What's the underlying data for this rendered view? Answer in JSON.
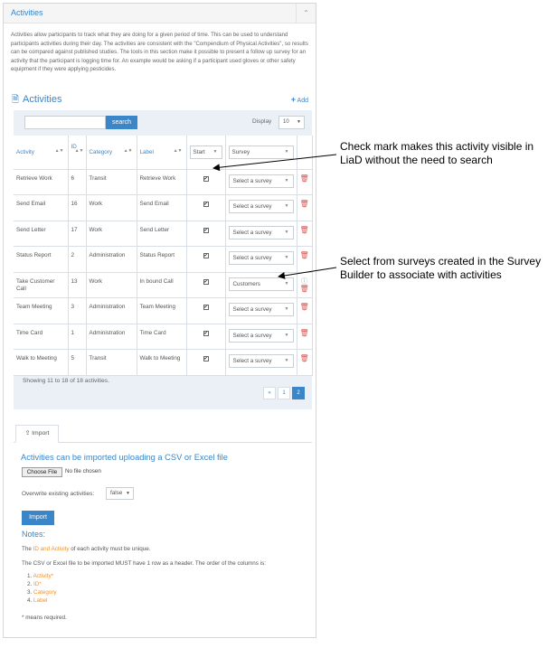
{
  "panel": {
    "title": "Activities"
  },
  "intro": "Activities allow participants to track what they are doing for a given period of time. This can be used to understand participants activities during their day. The activities are consistent with the \"Compendium of Physical Activities\", so results can be compared against published studies. The tools in this section make it possible to present a follow up survey for an activity that the participant is logging time for. An example would be asking if a participant used gloves or other safety equipment if they were applying pesticides.",
  "section": {
    "title": "Activities",
    "add_label": "Add"
  },
  "search": {
    "button_label": "search",
    "placeholder": ""
  },
  "display": {
    "label": "Display",
    "value": "10"
  },
  "columns": {
    "activity": "Activity",
    "id": "ID",
    "category": "Category",
    "label": "Label",
    "start": "Start",
    "survey": "Survey"
  },
  "rows": [
    {
      "activity": "Retrieve Work",
      "id": "6",
      "category": "Transit",
      "label": "Retrieve Work",
      "start": true,
      "survey": "Select a survey"
    },
    {
      "activity": "Send Email",
      "id": "16",
      "category": "Work",
      "label": "Send Email",
      "start": true,
      "survey": "Select a survey"
    },
    {
      "activity": "Send Letter",
      "id": "17",
      "category": "Work",
      "label": "Send Letter",
      "start": true,
      "survey": "Select a survey"
    },
    {
      "activity": "Status Report",
      "id": "2",
      "category": "Administration",
      "label": "Status Report",
      "start": true,
      "survey": "Select a survey"
    },
    {
      "activity": "Take Customer Call",
      "id": "13",
      "category": "Work",
      "label": "In bound Call",
      "start": true,
      "survey": "Customers"
    },
    {
      "activity": "Team Meeting",
      "id": "3",
      "category": "Administration",
      "label": "Team Meeting",
      "start": true,
      "survey": "Select a survey"
    },
    {
      "activity": "Time Card",
      "id": "1",
      "category": "Administration",
      "label": "Time Card",
      "start": true,
      "survey": "Select a survey"
    },
    {
      "activity": "Walk to Meeting",
      "id": "5",
      "category": "Transit",
      "label": "Walk to Meeting",
      "start": true,
      "survey": "Select a survey"
    }
  ],
  "showing": "Showing 11 to 18 of 18 activities.",
  "pager": {
    "prev": "«",
    "page1": "1",
    "page2": "2"
  },
  "import": {
    "tab_label": "Import",
    "heading": "Activities can be imported uploading a CSV or Excel file",
    "file_button": "Choose File",
    "file_status": "No file chosen",
    "overwrite_label": "Overwrite existing activities:",
    "overwrite_value": "false",
    "button_label": "Import",
    "notes_title": "Notes:",
    "note1_prefix": "The ",
    "note1_highlight": "ID and Activity",
    "note1_suffix": " of each activity must be unique.",
    "note2": "The CSV or Excel file to be imported MUST have 1 row as a header. The order of the columns is:",
    "columns_order": [
      "Activity*",
      "ID*",
      "Category",
      "Label"
    ],
    "required_note": "* means required."
  },
  "callouts": {
    "checkmark": "Check mark makes this activity visible in LiaD without the need to search",
    "survey": "Select from surveys created in the Survey Builder to associate with activities"
  },
  "colors": {
    "accent": "#3a86c8",
    "orange": "#f0922b",
    "danger": "#d9534f"
  }
}
